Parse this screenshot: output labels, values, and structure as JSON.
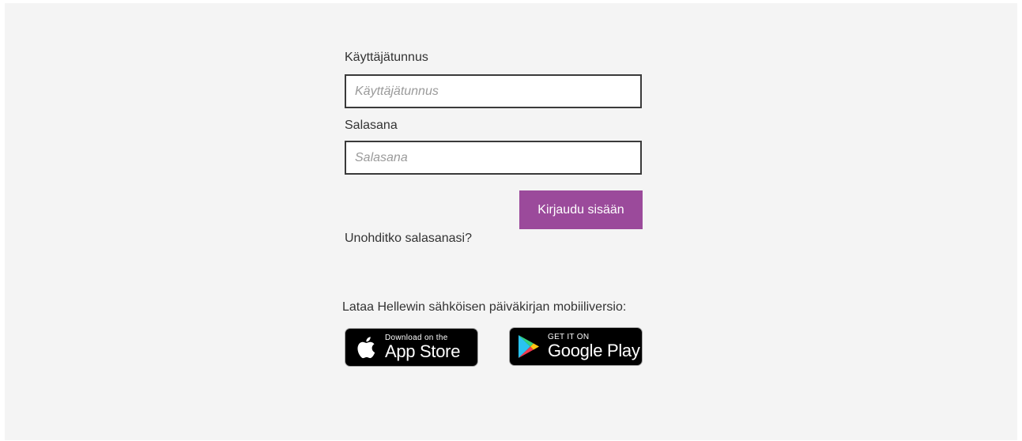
{
  "login": {
    "username_label": "Käyttäjätunnus",
    "username_placeholder": "Käyttäjätunnus",
    "username_value": "",
    "password_label": "Salasana",
    "password_placeholder": "Salasana",
    "password_value": "",
    "submit_label": "Kirjaudu sisään",
    "forgot_password": "Unohditko salasanasi?"
  },
  "mobile": {
    "download_text": "Lataa Hellewin sähköisen päiväkirjan mobiiliversio:",
    "appstore": {
      "small": "Download on the",
      "big": "App Store",
      "icon": "apple-icon"
    },
    "googleplay": {
      "small": "GET IT ON",
      "big": "Google Play",
      "icon": "google-play-icon"
    }
  },
  "colors": {
    "accent": "#9b4a9b",
    "background": "#f4f4f4",
    "text": "#333333",
    "badge_background": "#000000"
  }
}
